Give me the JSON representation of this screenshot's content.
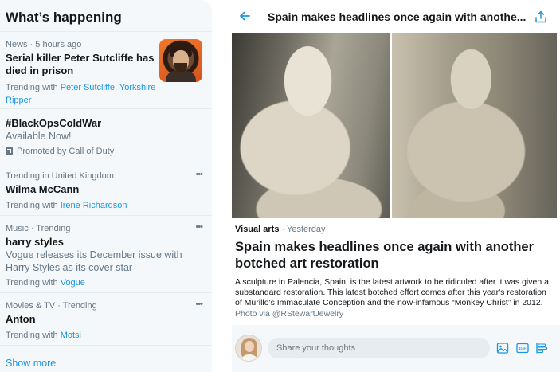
{
  "trends": {
    "title": "What’s happening",
    "items": [
      {
        "meta": "News · 5 hours ago",
        "name": "Serial killer Peter Sutcliffe has died in prison",
        "with_prefix": "Trending with",
        "with_links": "Peter Sutcliffe, Yorkshire Ripper"
      },
      {
        "name": "#BlackOpsColdWar",
        "desc": "Available Now!",
        "promo": "Promoted by Call of Duty"
      },
      {
        "meta": "Trending in United Kingdom",
        "name": "Wilma McCann",
        "with_prefix": "Trending with",
        "with_links": "Irene Richardson"
      },
      {
        "meta": "Music · Trending",
        "name": "harry styles",
        "desc": "Vogue releases its December issue with Harry Styles as its cover star",
        "with_prefix": "Trending with",
        "with_links": "Vogue"
      },
      {
        "meta": "Movies & TV · Trending",
        "name": "Anton",
        "with_prefix": "Trending with",
        "with_links": "Motsi"
      }
    ],
    "more_icon": "•••",
    "show_more": "Show more"
  },
  "article": {
    "header_title": "Spain makes headlines once again with anothe...",
    "category": "Visual arts",
    "when": " · Yesterday",
    "title": "Spain makes headlines once again with another botched art restoration",
    "summary": "A sculpture in Palencia, Spain, is the latest artwork to be ridiculed after it was given a substandard restoration. This latest botched effort comes after this year's restoration of Murillo's Immaculate Conception and the now-infamous “Monkey Christ” in 2012.",
    "credit": "Photo via @RStewartJewelry"
  },
  "compose": {
    "placeholder": "Share your thoughts"
  },
  "colors": {
    "accent": "#1b95e0",
    "muted": "#657786",
    "panel": "#f5f8fa"
  },
  "icons": [
    "back-arrow-icon",
    "share-icon",
    "more-icon",
    "promoted-icon",
    "image-icon",
    "gif-icon",
    "poll-icon"
  ]
}
